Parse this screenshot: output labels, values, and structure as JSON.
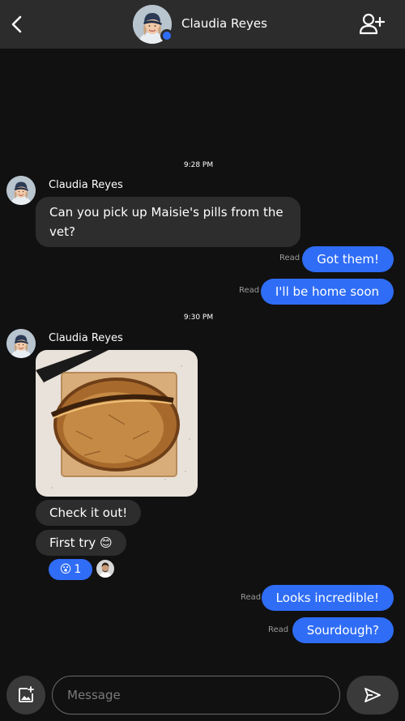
{
  "header": {
    "contact_name": "Claudia Reyes",
    "back_icon": "chevron-left-icon",
    "add_icon": "person-add-icon",
    "online": true
  },
  "messages": {
    "time_1": "9:28 PM",
    "time_2": "9:30 PM",
    "sender_1": "Claudia Reyes",
    "sender_2": "Claudia Reyes",
    "incoming_1": "Can you pick up Maisie's pills from the vet?",
    "outgoing_1": "Got them!",
    "outgoing_2": "I'll be home soon",
    "incoming_2": "Check it out!",
    "incoming_3": "First try 😊",
    "outgoing_3": "Looks incredible!",
    "outgoing_4": "Sourdough?",
    "read_label": "Read",
    "reaction_emoji": "😮",
    "reaction_count": "1"
  },
  "composer": {
    "placeholder": "Message",
    "photo_icon": "add-photo-icon",
    "send_icon": "send-icon"
  },
  "colors": {
    "accent": "#2f6df6",
    "header_bg": "#2c2c2c",
    "incoming_bg": "#2d2d2d",
    "page_bg": "#111111"
  }
}
